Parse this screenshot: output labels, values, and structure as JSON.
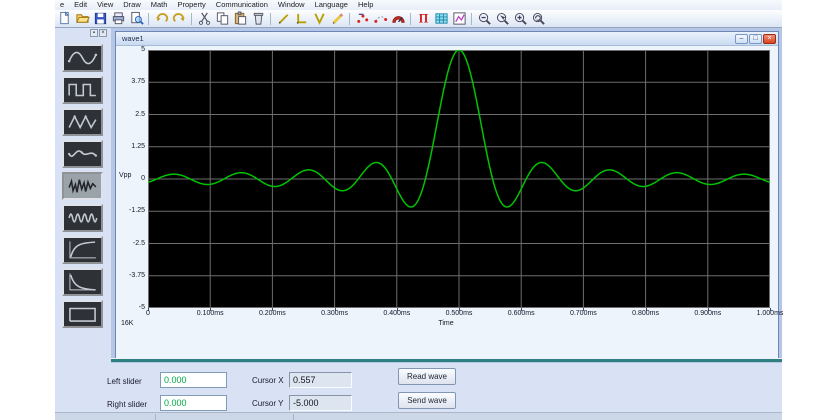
{
  "menu": {
    "items": [
      "e",
      "Edit",
      "View",
      "Draw",
      "Math",
      "Property",
      "Communication",
      "Window",
      "Language",
      "Help"
    ]
  },
  "toolbar": {
    "items": [
      "new",
      "open",
      "save",
      "print",
      "print-preview",
      "|",
      "undo",
      "redo",
      "|",
      "cut",
      "copy",
      "paste",
      "delete",
      "|",
      "line-tool",
      "polyline-tool",
      "vertex-tool",
      "pencil-tool",
      "|",
      "point-move-tool",
      "point-insert-tool",
      "gauge-tool",
      "|",
      "equation-tool",
      "table-tool",
      "chart-tool",
      "|",
      "zoom-out",
      "zoom-select",
      "zoom-in",
      "zoom-reset"
    ]
  },
  "toolbox": {
    "header_buttons": [
      {
        "name": "toolbox-pin-button",
        "glyph": "▪"
      },
      {
        "name": "toolbox-close-button",
        "glyph": "×"
      }
    ],
    "buttons": [
      {
        "name": "sine",
        "selected": false
      },
      {
        "name": "square",
        "selected": false
      },
      {
        "name": "triangle",
        "selected": false
      },
      {
        "name": "spline",
        "selected": false
      },
      {
        "name": "noise",
        "selected": true
      },
      {
        "name": "multi-sine",
        "selected": false
      },
      {
        "name": "exp-rise",
        "selected": false
      },
      {
        "name": "exp-decay",
        "selected": false
      },
      {
        "name": "pulse",
        "selected": false
      }
    ]
  },
  "wave_window": {
    "title": "wave1",
    "controls": {
      "minimize": "–",
      "restore": "□",
      "close": "×"
    }
  },
  "chart_data": {
    "type": "line",
    "title": "wave1",
    "xlabel": "Time",
    "ylabel": "Vpp",
    "points_label": "16K",
    "xlim_ms": [
      0,
      1
    ],
    "ylim": [
      -5,
      5
    ],
    "grid": true,
    "x_ticks": [
      "0",
      "0.100ms",
      "0.200ms",
      "0.300ms",
      "0.400ms",
      "0.500ms",
      "0.600ms",
      "0.700ms",
      "0.800ms",
      "0.900ms",
      "1.000ms"
    ],
    "y_ticks": [
      "5",
      "3.75",
      "2.5",
      "1.25",
      "0",
      "-1.25",
      "-2.5",
      "-3.75",
      "-5"
    ],
    "series": [
      {
        "name": "wave1",
        "color": "#00c400",
        "shape": "sinc",
        "amplitude": 5,
        "center_ms": 0.5,
        "zero_crossing_spacing_ms": 0.054,
        "extrema_points_ms_v": [
          [
            0.0,
            -0.12
          ],
          [
            0.041,
            0.19
          ],
          [
            0.095,
            -0.21
          ],
          [
            0.149,
            0.24
          ],
          [
            0.203,
            -0.29
          ],
          [
            0.257,
            0.35
          ],
          [
            0.311,
            -0.45
          ],
          [
            0.365,
            0.64
          ],
          [
            0.419,
            -1.06
          ],
          [
            0.5,
            5.0
          ],
          [
            0.581,
            -1.06
          ],
          [
            0.635,
            0.64
          ],
          [
            0.689,
            -0.45
          ],
          [
            0.743,
            0.35
          ],
          [
            0.797,
            -0.29
          ],
          [
            0.851,
            0.24
          ],
          [
            0.905,
            -0.21
          ],
          [
            0.959,
            0.19
          ],
          [
            1.0,
            -0.12
          ]
        ]
      }
    ]
  },
  "bottom_panel": {
    "left_slider": {
      "label": "Left slider",
      "value": "0.000"
    },
    "right_slider": {
      "label": "Right slider",
      "value": "0.000"
    },
    "cursor_x": {
      "label": "Cursor X",
      "value": "0.557"
    },
    "cursor_y": {
      "label": "Cursor Y",
      "value": "-5.000"
    },
    "read_button": "Read wave",
    "send_button": "Send wave"
  },
  "colors": {
    "curve_green": "#00c400",
    "slider_value_green": "#00a843",
    "plot_background": "#000000",
    "grid_line": "#6e6e6e",
    "mdi_background": "#b6c7e6",
    "panel_blue": "#d8e2f4",
    "teal_divider": "#2e7f7f",
    "close_button_red": "#d8431f"
  }
}
